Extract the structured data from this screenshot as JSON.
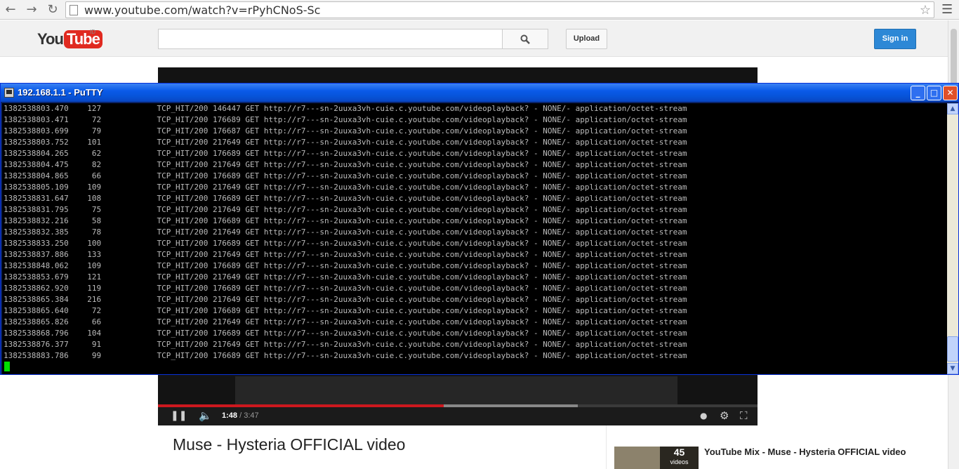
{
  "browser": {
    "url": "www.youtube.com/watch?v=rPyhCNoS-Sc",
    "icons": [
      "back-icon",
      "forward-icon",
      "reload-icon",
      "page-icon",
      "star-icon",
      "menu-icon"
    ]
  },
  "youtube": {
    "logo_you": "You",
    "logo_tube": "Tube",
    "country": "ID",
    "search_value": "",
    "upload_label": "Upload",
    "signin_label": "Sign in",
    "accent": "#2d88d6",
    "brand": "#e02a20"
  },
  "player": {
    "current_time": "1:48",
    "total_time": "/ 3:47",
    "played_fraction": 0.477,
    "loaded_fraction": 0.7
  },
  "video": {
    "title": "Muse - Hysteria OFFICIAL video"
  },
  "sidebar": {
    "mix_count": "45",
    "mix_count_label": "videos",
    "mix_title": "YouTube Mix - Muse - Hysteria OFFICIAL video"
  },
  "putty": {
    "title": "192.168.1.1 - PuTTY",
    "lines": [
      "1382538803.470    127            TCP_HIT/200 146447 GET http://r7---sn-2uuxa3vh-cuie.c.youtube.com/videoplayback? - NONE/- application/octet-stream",
      "1382538803.471     72            TCP_HIT/200 176689 GET http://r7---sn-2uuxa3vh-cuie.c.youtube.com/videoplayback? - NONE/- application/octet-stream",
      "1382538803.699     79            TCP_HIT/200 176687 GET http://r7---sn-2uuxa3vh-cuie.c.youtube.com/videoplayback? - NONE/- application/octet-stream",
      "1382538803.752    101            TCP_HIT/200 217649 GET http://r7---sn-2uuxa3vh-cuie.c.youtube.com/videoplayback? - NONE/- application/octet-stream",
      "1382538804.265     62            TCP_HIT/200 176689 GET http://r7---sn-2uuxa3vh-cuie.c.youtube.com/videoplayback? - NONE/- application/octet-stream",
      "1382538804.475     82            TCP_HIT/200 217649 GET http://r7---sn-2uuxa3vh-cuie.c.youtube.com/videoplayback? - NONE/- application/octet-stream",
      "1382538804.865     66            TCP_HIT/200 176689 GET http://r7---sn-2uuxa3vh-cuie.c.youtube.com/videoplayback? - NONE/- application/octet-stream",
      "1382538805.109    109            TCP_HIT/200 217649 GET http://r7---sn-2uuxa3vh-cuie.c.youtube.com/videoplayback? - NONE/- application/octet-stream",
      "1382538831.647    108            TCP_HIT/200 176689 GET http://r7---sn-2uuxa3vh-cuie.c.youtube.com/videoplayback? - NONE/- application/octet-stream",
      "1382538831.795     75            TCP_HIT/200 217649 GET http://r7---sn-2uuxa3vh-cuie.c.youtube.com/videoplayback? - NONE/- application/octet-stream",
      "1382538832.216     58            TCP_HIT/200 176689 GET http://r7---sn-2uuxa3vh-cuie.c.youtube.com/videoplayback? - NONE/- application/octet-stream",
      "1382538832.385     78            TCP_HIT/200 217649 GET http://r7---sn-2uuxa3vh-cuie.c.youtube.com/videoplayback? - NONE/- application/octet-stream",
      "1382538833.250    100            TCP_HIT/200 176689 GET http://r7---sn-2uuxa3vh-cuie.c.youtube.com/videoplayback? - NONE/- application/octet-stream",
      "1382538837.886    133            TCP_HIT/200 217649 GET http://r7---sn-2uuxa3vh-cuie.c.youtube.com/videoplayback? - NONE/- application/octet-stream",
      "1382538848.062    109            TCP_HIT/200 176689 GET http://r7---sn-2uuxa3vh-cuie.c.youtube.com/videoplayback? - NONE/- application/octet-stream",
      "1382538853.679    121            TCP_HIT/200 217649 GET http://r7---sn-2uuxa3vh-cuie.c.youtube.com/videoplayback? - NONE/- application/octet-stream",
      "1382538862.920    119            TCP_HIT/200 176689 GET http://r7---sn-2uuxa3vh-cuie.c.youtube.com/videoplayback? - NONE/- application/octet-stream",
      "1382538865.384    216            TCP_HIT/200 217649 GET http://r7---sn-2uuxa3vh-cuie.c.youtube.com/videoplayback? - NONE/- application/octet-stream",
      "1382538865.640     72            TCP_HIT/200 176689 GET http://r7---sn-2uuxa3vh-cuie.c.youtube.com/videoplayback? - NONE/- application/octet-stream",
      "1382538865.826     66            TCP_HIT/200 217649 GET http://r7---sn-2uuxa3vh-cuie.c.youtube.com/videoplayback? - NONE/- application/octet-stream",
      "1382538868.796    104            TCP_HIT/200 176689 GET http://r7---sn-2uuxa3vh-cuie.c.youtube.com/videoplayback? - NONE/- application/octet-stream",
      "1382538876.377     91            TCP_HIT/200 217649 GET http://r7---sn-2uuxa3vh-cuie.c.youtube.com/videoplayback? - NONE/- application/octet-stream",
      "1382538883.786     99            TCP_HIT/200 176689 GET http://r7---sn-2uuxa3vh-cuie.c.youtube.com/videoplayback? - NONE/- application/octet-stream"
    ],
    "cursor_color": "#00dd00"
  }
}
